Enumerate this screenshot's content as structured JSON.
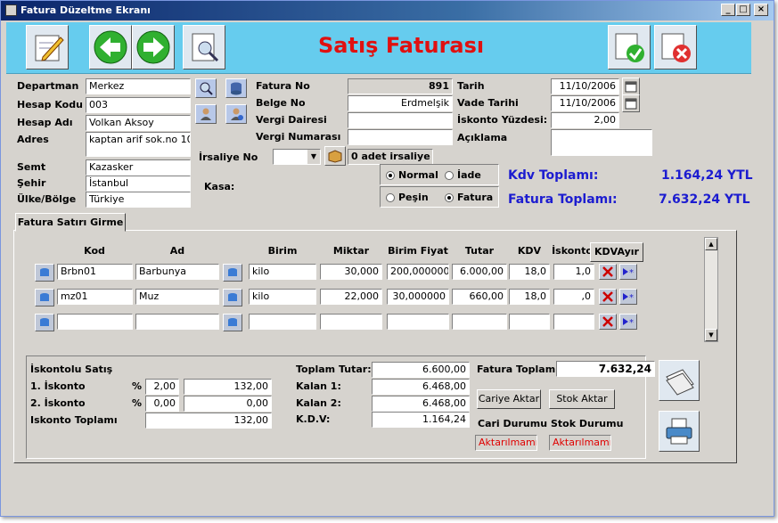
{
  "window": {
    "title": "Fatura Düzeltme Ekranı",
    "min": "_",
    "max": "□",
    "close": "×"
  },
  "toolbar": {
    "title": "Satış Faturası"
  },
  "left": {
    "departman_label": "Departman",
    "departman": "Merkez",
    "hesap_kodu_label": "Hesap Kodu",
    "hesap_kodu": "003",
    "hesap_adi_label": "Hesap Adı",
    "hesap_adi": "Volkan Aksoy",
    "adres_label": "Adres",
    "adres": "kaptan arif sok.no 10",
    "semt_label": "Semt",
    "semt": "Kazasker",
    "sehir_label": "Şehir",
    "sehir": "İstanbul",
    "ulke_label": "Ülke/Bölge",
    "ulke": "Türkiye"
  },
  "mid": {
    "fatura_no_label": "Fatura No",
    "fatura_no": "891",
    "belge_no_label": "Belge No",
    "belge_no": "Erdmelşik",
    "vergi_dairesi_label": "Vergi Dairesi",
    "vergi_dairesi": "",
    "vergi_no_label": "Vergi Numarası",
    "vergi_no": "",
    "irsaliye_label": "İrsaliye No",
    "irsaliye_count": "0 adet irsaliye",
    "kasa_label": "Kasa:"
  },
  "right": {
    "tarih_label": "Tarih",
    "tarih": "11/10/2006",
    "vade_label": "Vade Tarihi",
    "vade": "11/10/2006",
    "iskonto_label": "İskonto Yüzdesi:",
    "iskonto": "2,00",
    "aciklama_label": "Açıklama"
  },
  "radios": {
    "normal": "Normal",
    "iade": "İade",
    "pesin": "Peşin",
    "fatura": "Fatura"
  },
  "totals": {
    "kdv_label": "Kdv Toplamı:",
    "kdv": "1.164,24 YTL",
    "fatura_label": "Fatura Toplamı:",
    "fatura": "7.632,24 YTL"
  },
  "tab": {
    "label": "Fatura Satırı Girme"
  },
  "grid": {
    "headers": {
      "kod": "Kod",
      "ad": "Ad",
      "birim": "Birim",
      "miktar": "Miktar",
      "birim_fiyat": "Birim Fiyat",
      "tutar": "Tutar",
      "kdv": "KDV",
      "iskonto": "İskonto"
    },
    "kdv_button": "KDVAyır",
    "rows": [
      {
        "kod": "Brbn01",
        "ad": "Barbunya",
        "birim": "kilo",
        "miktar": "30,000",
        "fiyat": "200,000000",
        "tutar": "6.000,00",
        "kdv": "18,0",
        "isk": "1,0"
      },
      {
        "kod": "mz01",
        "ad": "Muz",
        "birim": "kilo",
        "miktar": "22,000",
        "fiyat": "30,000000",
        "tutar": "660,00",
        "kdv": "18,0",
        "isk": ",0"
      },
      {
        "kod": "",
        "ad": "",
        "birim": "",
        "miktar": "",
        "fiyat": "",
        "tutar": "",
        "kdv": "",
        "isk": ""
      }
    ]
  },
  "bottom": {
    "iskontolu_label": "İskontolu Satış",
    "isk1_label": "1. İskonto",
    "isk1_pct": "2,00",
    "isk1_val": "132,00",
    "isk2_label": "2. İskonto",
    "isk2_pct": "0,00",
    "isk2_val": "0,00",
    "isk_toplam_label": "Iskonto Toplamı",
    "isk_toplam": "132,00",
    "pct": "%",
    "toplam_tutar_label": "Toplam Tutar:",
    "toplam_tutar": "6.600,00",
    "kalan1_label": "Kalan 1:",
    "kalan1": "6.468,00",
    "kalan2_label": "Kalan 2:",
    "kalan2": "6.468,00",
    "kdv_label": "K.D.V:",
    "kdv": "1.164,24",
    "fatura_toplami_label": "Fatura Toplamı",
    "fatura_toplami": "7.632,24",
    "cariye_aktar": "Cariye Aktar",
    "stok_aktar": "Stok Aktar",
    "cari_durumu_label": "Cari Durumu",
    "stok_durumu_label": "Stok Durumu",
    "cari_durumu": "Aktarılmamış",
    "stok_durumu": "Aktarılmamış"
  }
}
